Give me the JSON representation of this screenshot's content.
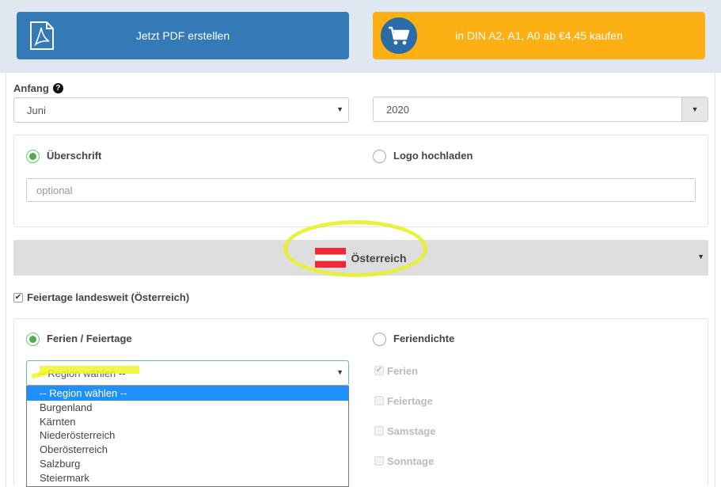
{
  "actions": {
    "pdf_label": "Jetzt PDF erstellen",
    "buy_label": "in DIN A2, A1, A0 ab €4,45 kaufen"
  },
  "start": {
    "label": "Anfang",
    "help_icon": "?",
    "month_value": "Juni",
    "year_value": "2020"
  },
  "title_panel": {
    "option_heading": "Überschrift",
    "option_logo": "Logo hochladen",
    "heading_placeholder": "optional"
  },
  "country": {
    "name": "Österreich",
    "flag_colors": [
      "#ed2939",
      "#ffffff",
      "#ed2939"
    ]
  },
  "holidays_national": {
    "label": "Feiertage landesweit (Österreich)",
    "checked": true
  },
  "mode_panel": {
    "option_holidays": "Ferien / Feiertage",
    "option_density": "Feriendichte",
    "region_value": "-- Region wählen --",
    "region_options": [
      "-- Region wählen --",
      "Burgenland",
      "Kärnten",
      "Niederösterreich",
      "Oberösterreich",
      "Salzburg",
      "Steiermark"
    ],
    "density_checks": [
      {
        "label": "Ferien",
        "checked": true
      },
      {
        "label": "Feiertage",
        "checked": false
      },
      {
        "label": "Samstage",
        "checked": false
      },
      {
        "label": "Sonntage",
        "checked": false
      }
    ]
  },
  "colors": {
    "pdf_button": "#347ab7",
    "buy_button": "#fdb013",
    "highlight": "#e8ef2a",
    "selected_option": "#1e90ff"
  }
}
